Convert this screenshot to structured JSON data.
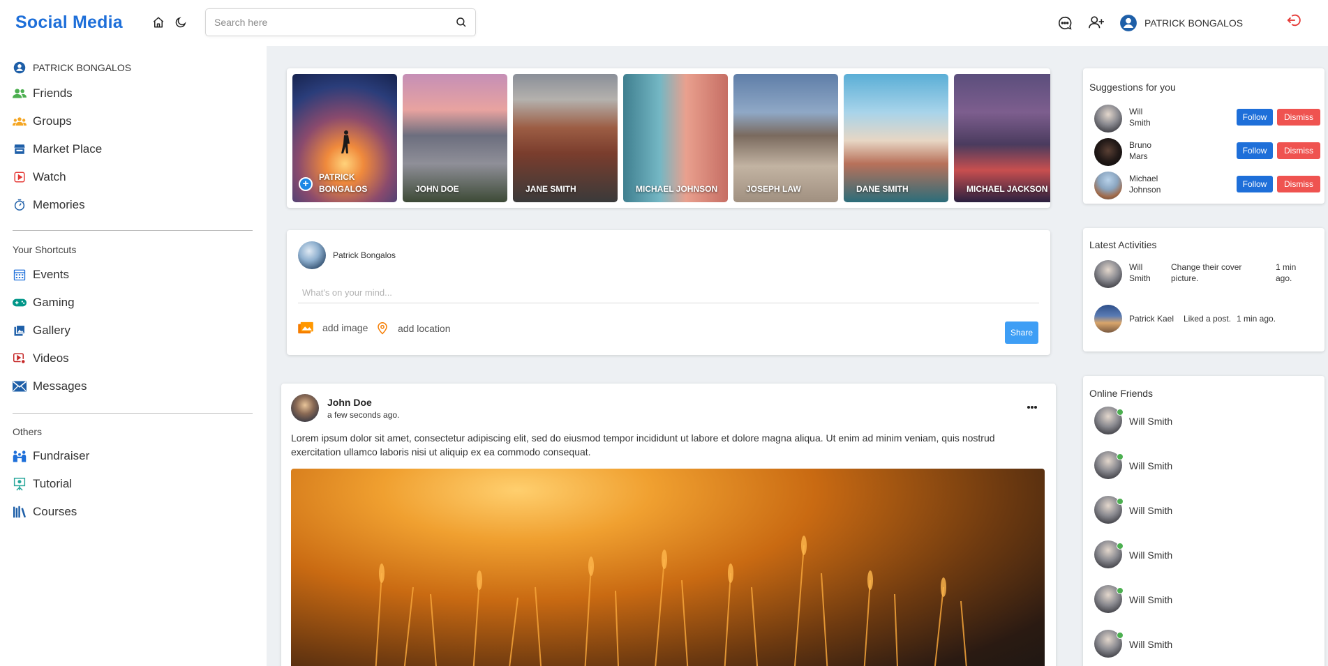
{
  "header": {
    "logo": "Social Media",
    "search_placeholder": "Search here",
    "user_name": "PATRICK BONGALOS",
    "icons": [
      "home-icon",
      "moon-icon",
      "search-icon",
      "chat-icon",
      "add-friend-icon",
      "user-icon",
      "logout-icon"
    ]
  },
  "sidebar": {
    "profile": "PATRICK BONGALOS",
    "main_items": [
      {
        "label": "Friends",
        "icon": "friends-icon",
        "color": "#4caf50"
      },
      {
        "label": "Groups",
        "icon": "groups-icon",
        "color": "#f5a623"
      },
      {
        "label": "Market Place",
        "icon": "store-icon",
        "color": "#1e5fa8"
      },
      {
        "label": "Watch",
        "icon": "video-play-icon",
        "color": "#e53935"
      },
      {
        "label": "Memories",
        "icon": "timer-icon",
        "color": "#1e5fa8"
      }
    ],
    "shortcuts_heading": "Your Shortcuts",
    "shortcut_items": [
      {
        "label": "Events",
        "icon": "calendar-icon",
        "color": "#1e6fd9"
      },
      {
        "label": "Gaming",
        "icon": "gamepad-icon",
        "color": "#009688"
      },
      {
        "label": "Gallery",
        "icon": "gallery-icon",
        "color": "#1e5fa8"
      },
      {
        "label": "Videos",
        "icon": "video-settings-icon",
        "color": "#c62828"
      },
      {
        "label": "Messages",
        "icon": "envelope-icon",
        "color": "#1e5fa8"
      }
    ],
    "others_heading": "Others",
    "other_items": [
      {
        "label": "Fundraiser",
        "icon": "fundraiser-icon",
        "color": "#1e6fd9"
      },
      {
        "label": "Tutorial",
        "icon": "tutorial-icon",
        "color": "#26a69a"
      },
      {
        "label": "Courses",
        "icon": "books-icon",
        "color": "#1e5fa8"
      }
    ]
  },
  "stories": [
    {
      "name": "PATRICK BONGALOS",
      "own": true
    },
    {
      "name": "JOHN DOE"
    },
    {
      "name": "JANE SMITH"
    },
    {
      "name": "MICHAEL JOHNSON"
    },
    {
      "name": "JOSEPH LAW"
    },
    {
      "name": "DANE SMITH"
    },
    {
      "name": "MICHAEL JACKSON"
    }
  ],
  "composer": {
    "user": "Patrick Bongalos",
    "placeholder": "What's on your mind...",
    "add_image": "add image",
    "add_location": "add location",
    "share": "Share"
  },
  "post": {
    "author": "John Doe",
    "time": "a few seconds ago.",
    "text": "Lorem ipsum dolor sit amet, consectetur adipiscing elit, sed do eiusmod tempor incididunt ut labore et dolore magna aliqua. Ut enim ad minim veniam, quis nostrud exercitation ullamco laboris nisi ut aliquip ex ea commodo consequat."
  },
  "suggestions": {
    "title": "Suggestions for you",
    "follow": "Follow",
    "dismiss": "Dismiss",
    "people": [
      {
        "first": "Will",
        "last": "Smith"
      },
      {
        "first": "Bruno",
        "last": "Mars"
      },
      {
        "first": "Michael",
        "last": "Johnson"
      }
    ]
  },
  "activities": {
    "title": "Latest Activities",
    "items": [
      {
        "first": "Will",
        "last": "Smith",
        "action_1": "Change their cover",
        "action_2": "picture.",
        "time_1": "1 min",
        "time_2": "ago."
      },
      {
        "name": "Patrick Kael",
        "action": "Liked a post.",
        "time": "1 min ago."
      }
    ]
  },
  "online": {
    "title": "Online Friends",
    "friends": [
      "Will Smith",
      "Will Smith",
      "Will Smith",
      "Will Smith",
      "Will Smith",
      "Will Smith"
    ]
  },
  "colors": {
    "brand": "#1e6fd9",
    "share": "#3e9ef5",
    "dismiss": "#ef5350",
    "online": "#4caf50",
    "logout": "#e53935"
  }
}
